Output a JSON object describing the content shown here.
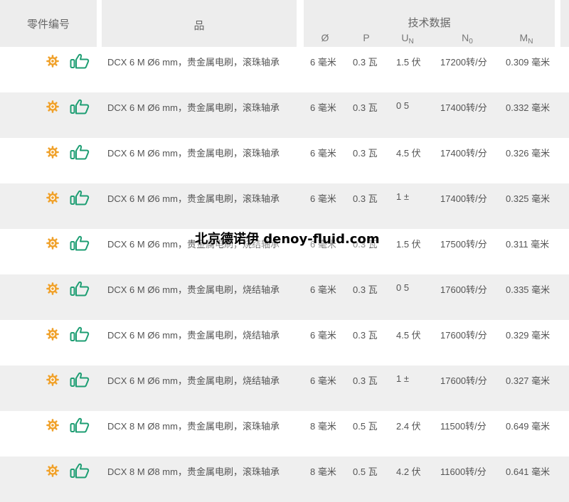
{
  "header": {
    "part_no": "零件编号",
    "product": "品",
    "tech_data": "技术数据",
    "col_diameter": "Ø",
    "col_power": "P",
    "col_voltage": "U",
    "col_voltage_sub": "N",
    "col_speed": "N",
    "col_speed_sub": "0",
    "col_torque": "M",
    "col_torque_sub": "N"
  },
  "rows": [
    {
      "desc": "DCX 6 M Ø6 mm，贵金属电刷，滚珠轴承",
      "diameter": "6 毫米",
      "power": "0.3 瓦",
      "voltage": "1.5 伏",
      "speed": "17200转/分",
      "torque": "0.309 毫米"
    },
    {
      "desc": "DCX 6 M Ø6 mm，贵金属电刷，滚珠轴承",
      "diameter": "6 毫米",
      "power": "0.3 瓦",
      "voltage": "0 5",
      "speed": "17400转/分",
      "torque": "0.332 毫米"
    },
    {
      "desc": "DCX 6 M Ø6 mm，贵金属电刷，滚珠轴承",
      "diameter": "6 毫米",
      "power": "0.3 瓦",
      "voltage": "4.5 伏",
      "speed": "17400转/分",
      "torque": "0.326 毫米"
    },
    {
      "desc": "DCX 6 M Ø6 mm，贵金属电刷，滚珠轴承",
      "diameter": "6 毫米",
      "power": "0.3 瓦",
      "voltage": "1 ±",
      "speed": "17400转/分",
      "torque": "0.325 毫米"
    },
    {
      "desc": "DCX 6 M Ø6 mm，贵金属电刷，烧结轴承",
      "diameter": "6 毫米",
      "power": "0.3 瓦",
      "voltage": "1.5 伏",
      "speed": "17500转/分",
      "torque": "0.311 毫米"
    },
    {
      "desc": "DCX 6 M Ø6 mm，贵金属电刷，烧结轴承",
      "diameter": "6 毫米",
      "power": "0.3 瓦",
      "voltage": "0 5",
      "speed": "17600转/分",
      "torque": "0.335 毫米"
    },
    {
      "desc": "DCX 6 M Ø6 mm，贵金属电刷，烧结轴承",
      "diameter": "6 毫米",
      "power": "0.3 瓦",
      "voltage": "4.5 伏",
      "speed": "17600转/分",
      "torque": "0.329 毫米"
    },
    {
      "desc": "DCX 6 M Ø6 mm，贵金属电刷，烧结轴承",
      "diameter": "6 毫米",
      "power": "0.3 瓦",
      "voltage": "1 ±",
      "speed": "17600转/分",
      "torque": "0.327 毫米"
    },
    {
      "desc": "DCX 8 M Ø8 mm，贵金属电刷，滚珠轴承",
      "diameter": "8 毫米",
      "power": "0.5 瓦",
      "voltage": "2.4 伏",
      "speed": "11500转/分",
      "torque": "0.649 毫米"
    },
    {
      "desc": "DCX 8 M Ø8 mm，贵金属电刷，滚珠轴承",
      "diameter": "8 毫米",
      "power": "0.5 瓦",
      "voltage": "4.2 伏",
      "speed": "11600转/分",
      "torque": "0.641 毫米"
    }
  ],
  "watermark": "北京德诺伊 denoy-fluid.com",
  "colors": {
    "gear": "#f0a12a",
    "thumb": "#1e9e73",
    "header_bg": "#ededed",
    "row_alt_bg": "#efefef"
  },
  "icons": {
    "configure": "gear-icon",
    "recommend": "thumbs-up-icon"
  }
}
